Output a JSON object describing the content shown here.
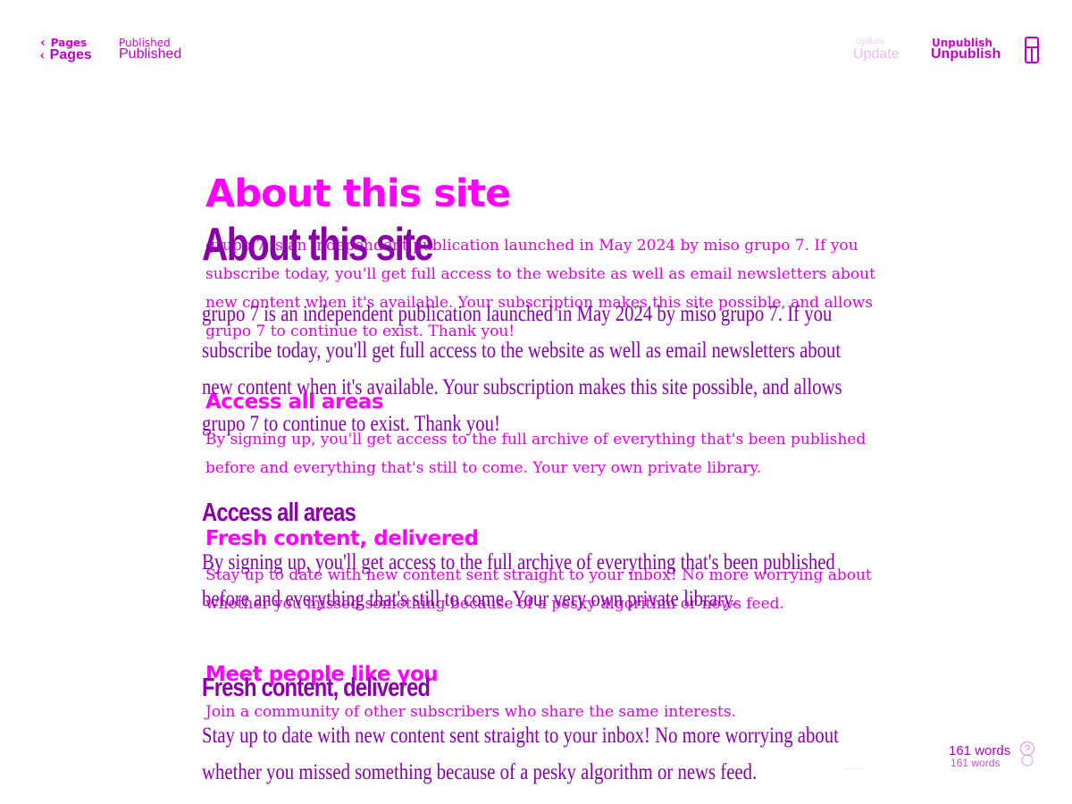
{
  "topbar": {
    "back_label": "Pages",
    "status": "Published",
    "update_label": "Update",
    "unpublish_label": "Unpublish"
  },
  "article": {
    "title": "About this site",
    "intro": "grupo 7 is an independent publication launched in May 2024 by miso grupo 7. If you subscribe today, you'll get full access to the website as well as email newsletters about new content when it's available. Your subscription makes this site possible, and allows grupo 7 to continue to exist. Thank you!",
    "sections": [
      {
        "heading": "Access all areas",
        "body": "By signing up, you'll get access to the full archive of everything that's been published before and everything that's still to come. Your very own private library."
      },
      {
        "heading": "Fresh content, delivered",
        "body": "Stay up to date with new content sent straight to your inbox! No more worrying about whether you missed something because of a pesky algorithm or news feed."
      },
      {
        "heading": "Meet people like you",
        "body": "Join a community of other subscribers who share the same interests."
      }
    ]
  },
  "footer": {
    "word_count": "161 words"
  },
  "icons": {
    "back": "chevron-left-icon",
    "panel": "sidebar-panel-icon",
    "help": "help-icon"
  },
  "colors": {
    "accent": "#c000c8",
    "ghost": "#ff00ff",
    "text": "#8a00a8"
  }
}
